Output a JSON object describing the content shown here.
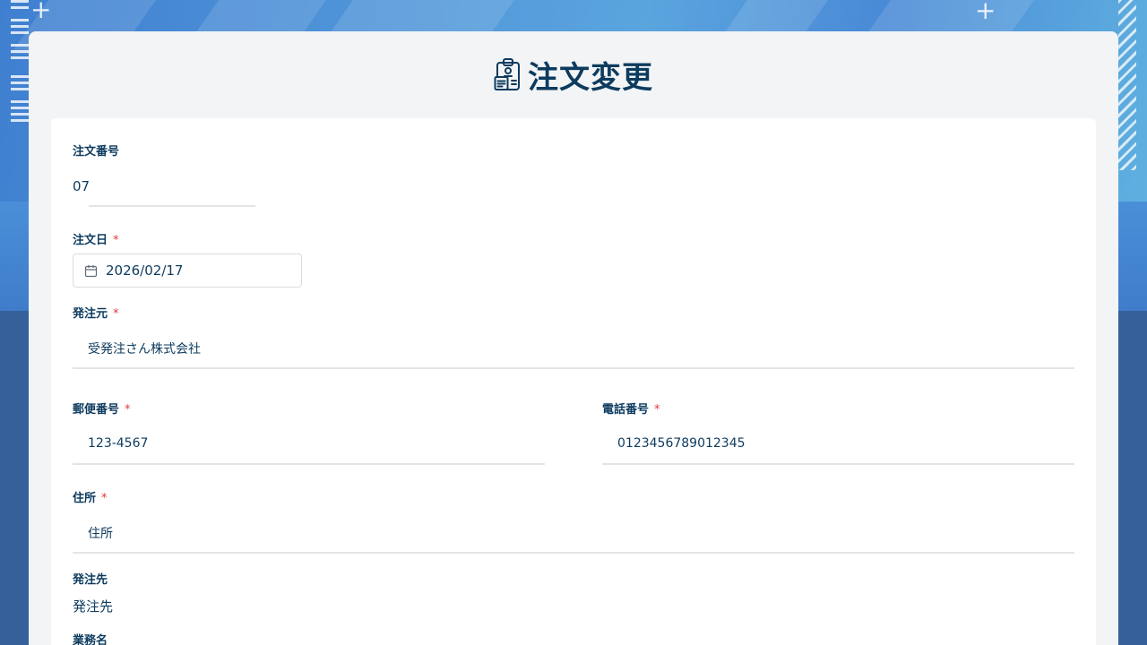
{
  "header": {
    "title": "注文変更",
    "title_icon": "clipboard-document-icon"
  },
  "form": {
    "order_number": {
      "label": "注文番号",
      "value": "07"
    },
    "order_date": {
      "label": "注文日",
      "required_mark": "*",
      "value": "2026/02/17",
      "icon": "calendar-icon"
    },
    "orderer": {
      "label": "発注元",
      "required_mark": "*",
      "value": "受発注さん株式会社"
    },
    "postal_code": {
      "label": "郵便番号",
      "required_mark": "*",
      "value": "123-4567"
    },
    "phone": {
      "label": "電話番号",
      "required_mark": "*",
      "value": "0123456789012345"
    },
    "address": {
      "label": "住所",
      "required_mark": "*",
      "value": "住所"
    },
    "supplier": {
      "label": "発注先",
      "value": "発注先"
    },
    "job_name": {
      "label": "業務名"
    }
  },
  "colors": {
    "text_primary": "#0d3b5e",
    "required": "#e03a3a",
    "panel_bg": "#f2f4f6",
    "card_bg": "#ffffff",
    "page_bg": "#35609a"
  }
}
